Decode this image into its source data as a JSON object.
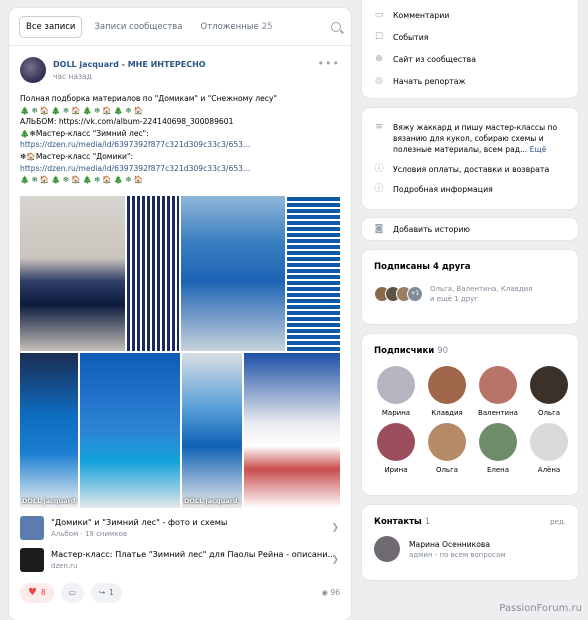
{
  "tabs": [
    {
      "label": "Все записи",
      "count": ""
    },
    {
      "label": "Записи сообщества",
      "count": ""
    },
    {
      "label": "Отложенные",
      "count": "25"
    }
  ],
  "post": {
    "author": "DOLL jacquard - МНЕ ИНТЕРЕСНО",
    "time": "час назад",
    "lines": [
      "Полная подборка материалов по \"Домикам\" и \"Снежному лесу\"",
      "🎄❄🏠🎄❄🏠🎄❄🏠🎄❄🏠",
      "АЛЬБОМ: https://vk.com/album-224140698_300089601",
      "🎄❄Мастер-класс \"Зимний лес\":",
      "https://dzen.ru/media/id/6397392f877c321d309c33c3/653...",
      "❄🏠Мастер-класс \"Домики\":",
      "https://dzen.ru/media/id/6397392f877c321d309c33c3/653...",
      "🎄❄🏠🎄❄🏠🎄❄🏠🎄❄🏠"
    ],
    "watermark_1": "DOLL jacquard - МНЕ ИНТЕРЕСНО",
    "watermark_2": "DOLL jacquard - МНЕ ИНТЕРЕСНО",
    "attachments": [
      {
        "title": "\"Домики\" и \"Зимний лес\" - фото и схемы",
        "sub": "Альбом · 19 снимков"
      },
      {
        "title": "Мастер-класс: Платье \"Зимний лес\" для Паолы Рейна - описани...",
        "sub": "dzen.ru"
      }
    ],
    "likes": "8",
    "reposts": "1",
    "views": "96"
  },
  "menu_top": [
    {
      "label": "Комментарии",
      "icon": "comment-icon"
    },
    {
      "label": "События",
      "icon": "event-icon"
    },
    {
      "label": "Сайт из сообщества",
      "icon": "globe-icon"
    },
    {
      "label": "Начать репортаж",
      "icon": "broadcast-icon"
    }
  ],
  "about": {
    "text_1": "Вяжу жаккард и пишу мастер-классы по",
    "text_2": "вязанию для кукол, собираю схемы и",
    "text_3": "полезные материалы, всем рад...",
    "more": "Ещё",
    "terms": "Условия оплаты, доставки и возврата",
    "info": "Подробная информация"
  },
  "story": {
    "label": "Добавить историю"
  },
  "friends": {
    "title": "Подписаны 4 друга",
    "names": "Ольга, Валентина, Клавдия",
    "more": "и ещё 1 друг",
    "plus": "+1"
  },
  "subscribers": {
    "title": "Подписчики",
    "count": "90",
    "items": [
      {
        "name": "Марина",
        "color": "#b7b3c0"
      },
      {
        "name": "Клавдия",
        "color": "#a0664a"
      },
      {
        "name": "Валентина",
        "color": "#b9746a"
      },
      {
        "name": "Ольга",
        "color": "#3b3128"
      },
      {
        "name": "Ирина",
        "color": "#9a4d5a"
      },
      {
        "name": "Ольга",
        "color": "#b58a66"
      },
      {
        "name": "Елена",
        "color": "#6e8b6a"
      },
      {
        "name": "Алёна",
        "color": "#d9d9d9"
      }
    ]
  },
  "contacts": {
    "title": "Контакты",
    "count": "1",
    "edit": "ред.",
    "name": "Марина Осенникова",
    "role": "админ - по всем вопросам"
  },
  "footer": "PassionForum.ru"
}
